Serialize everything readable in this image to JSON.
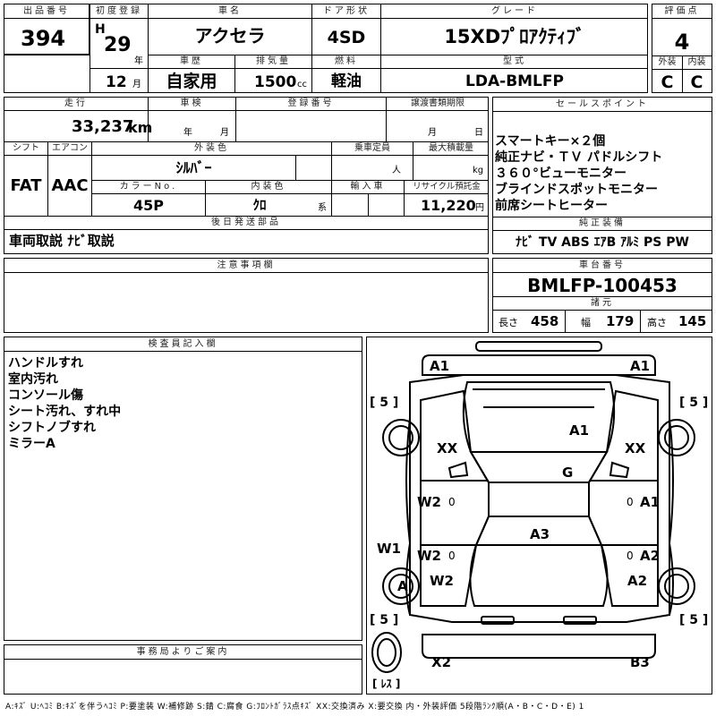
{
  "header": {
    "lot_no_label": "出品番号",
    "lot_no": "394",
    "first_reg_label": "初度登録",
    "era": "H",
    "year": "29",
    "year_unit": "年",
    "month": "12",
    "month_unit": "月",
    "car_name_label": "車名",
    "car_name": "アクセラ",
    "door_label": "ドア形状",
    "door": "4SD",
    "grade_label": "グレード",
    "grade": "15XDﾌﾟﾛｱｸﾃｨﾌﾞ",
    "score_label": "評価点",
    "score": "4",
    "history_label": "車歴",
    "history": "自家用",
    "displacement_label": "排気量",
    "displacement": "1500",
    "displacement_unit": "cc",
    "fuel_label": "燃料",
    "fuel": "軽油",
    "model_label": "型式",
    "model": "LDA-BMLFP",
    "ext_label": "外装",
    "ext": "C",
    "int_label": "内装",
    "int": "C"
  },
  "mid": {
    "mileage_label": "走行",
    "mileage": "33,237",
    "mileage_unit": "km",
    "inspection_label": "車検",
    "insp_year_unit": "年",
    "insp_month_unit": "月",
    "reg_no_label": "登録番号",
    "transfer_label": "譲渡書類期限",
    "transfer_month_unit": "月",
    "transfer_day_unit": "日",
    "shift_label": "シフト",
    "shift": "FAT",
    "ac_label": "エアコン",
    "ac": "AAC",
    "exterior_color_label": "外装色",
    "exterior_color": "ｼﾙﾊﾞｰ",
    "capacity_label": "乗車定員",
    "capacity_unit": "人",
    "load_label": "最大積載量",
    "load_unit": "kg",
    "color_no_label": "カラーNo.",
    "color_no": "45P",
    "interior_color_label": "内装色",
    "interior_color": "ｸﾛ",
    "interior_color_unit": "系",
    "import_label": "輸入車",
    "recycle_label": "リサイクル預託金",
    "recycle": "11,220",
    "recycle_unit": "円",
    "later_parts_label": "後日発送部品",
    "later_parts": "車両取説 ﾅﾋﾞ取説"
  },
  "sales": {
    "label": "セールスポイント",
    "points": [
      "スマートキー×２個",
      "純正ナビ・ＴＶ パドルシフト",
      "３６０°ビューモニター",
      "ブラインドスポットモニター",
      "前席シートヒーター"
    ],
    "equip_label": "純正装備",
    "equip": "ﾅﾋﾞ TV ABS ｴｱB ｱﾙﾐ PS PW"
  },
  "notes": {
    "label": "注意事項欄"
  },
  "chassis": {
    "label": "車台番号",
    "number": "BMLFP-100453",
    "spec_label": "諸元",
    "length_label": "長さ",
    "length": "458",
    "width_label": "幅",
    "width": "179",
    "height_label": "高さ",
    "height": "145"
  },
  "inspector": {
    "label": "検査員記入欄",
    "lines": [
      "ハンドルすれ",
      "室内汚れ",
      "コンソール傷",
      "シート汚れ、すれ中",
      "シフトノブすれ",
      "ミラーA"
    ]
  },
  "office": {
    "label": "事務局よりご案内"
  },
  "diagram": {
    "marks": {
      "front_left": "A1",
      "front_right": "A1",
      "hood": "A1",
      "roof": "G",
      "trunk": "A3",
      "fender_left": "XX",
      "fender_right": "XX",
      "door_fl": "W2",
      "door_rl": "W2",
      "quarter_l": "W2",
      "sill_l": "W1",
      "wheel_rl": "A",
      "door_fr": "A1",
      "door_rr": "A2",
      "quarter_r": "A2",
      "rear_left": "X2",
      "rear_right": "B3"
    },
    "tire_fl": "[ 5 ]",
    "tire_fr": "[ 5 ]",
    "tire_rl": "[ 5 ]",
    "tire_rr": "[ 5 ]",
    "spare": "[ ﾚｽ ]",
    "door_zero": "0"
  },
  "legend": "A:ｷｽﾞ U:ﾍｺﾐ B:ｷｽﾞを伴うﾍｺﾐ P:要塗装 W:補修跡 S:錆 C:腐食 G:ﾌﾛﾝﾄｶﾞﾗｽ点ｷｽﾞ XX:交換済み X:要交換 内・外装評価 5段階ﾗﾝｸ順(A・B・C・D・E) 1"
}
